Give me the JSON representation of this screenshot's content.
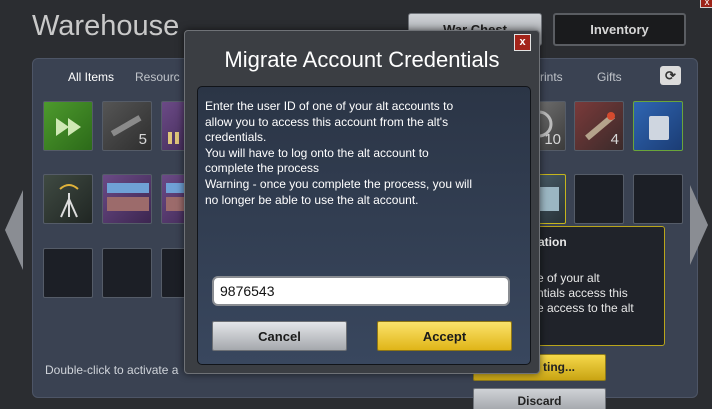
{
  "warehouse": {
    "title": "Warehouse",
    "war_chest_label": "War Chest",
    "inventory_label": "Inventory",
    "corner_close": "x",
    "tabs": [
      "All Items",
      "Resourc",
      "rints",
      "Gifts"
    ],
    "refresh_icon": "refresh-icon",
    "slot_counts": {
      "gun": "5",
      "gauge": "10",
      "missile": "4"
    },
    "hint": "Double-click to activate a",
    "info": {
      "title": "ation",
      "desc": [
        "e of your alt",
        "ntials access this",
        "e access to the alt"
      ]
    },
    "activate_label": "ting...",
    "discard_label": "Discard"
  },
  "modal": {
    "title": "Migrate Account Credentials",
    "close_label": "x",
    "message": [
      "Enter the user ID of one of your alt accounts to",
      "allow you to access this account from the alt's",
      "credentials.",
      "You will have to log onto the alt account to",
      "complete the process",
      "Warning - once you complete the process, you will",
      "no longer be able to use the alt account."
    ],
    "input_value": "9876543",
    "cancel_label": "Cancel",
    "accept_label": "Accept"
  },
  "colors": {
    "accept": "#f5cf2e",
    "close": "#a3241a",
    "panel": "#3a4252"
  }
}
